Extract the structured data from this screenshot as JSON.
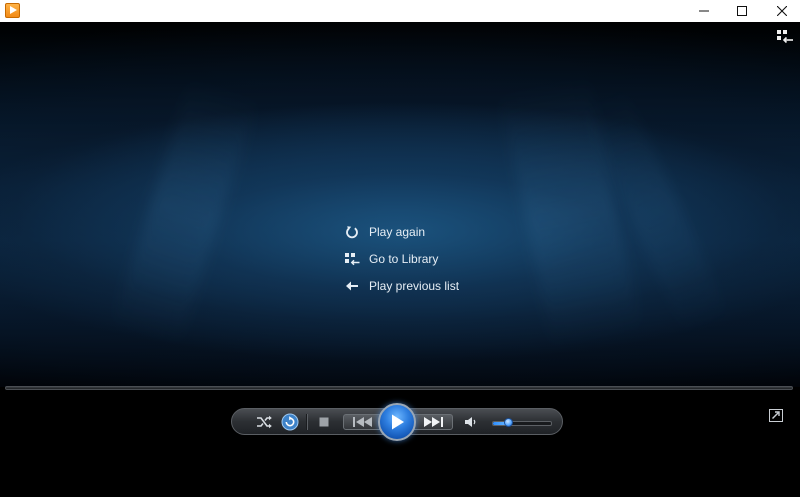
{
  "titlebar": {
    "app_icon": "media-player-icon",
    "buttons": {
      "minimize": "minimize-icon",
      "maximize": "maximize-icon",
      "close": "close-icon"
    }
  },
  "video": {
    "top_right_icon": "library-toggle-icon"
  },
  "menu": {
    "items": [
      {
        "label": "Play again",
        "icon": "replay-icon"
      },
      {
        "label": "Go to Library",
        "icon": "library-icon"
      },
      {
        "label": "Play previous list",
        "icon": "arrow-left-icon"
      }
    ]
  },
  "controls": {
    "shuffle": "shuffle-icon",
    "repeat": "repeat-icon",
    "stop": "stop-icon",
    "previous": "previous-icon",
    "play": "play-icon",
    "next": "next-icon",
    "volume_icon": "speaker-icon",
    "volume_level": 0.25,
    "now_playing_toggle": "switch-to-now-playing-icon"
  },
  "colors": {
    "accent": "#2f7fe0",
    "titlebar_bg": "#ffffff",
    "app_icon": "#f28a16",
    "text": "#e6eef5"
  }
}
